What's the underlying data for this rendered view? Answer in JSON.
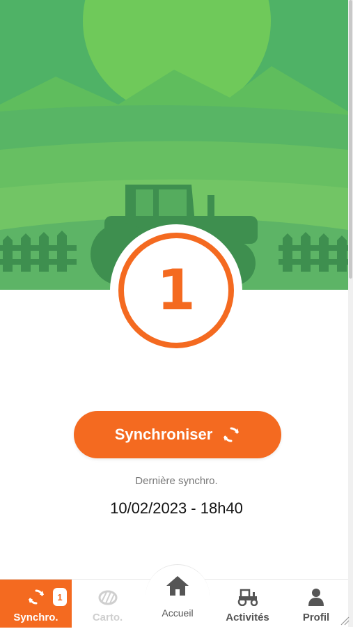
{
  "colors": {
    "accent": "#f46a20",
    "hero_green_light": "#6fc95a",
    "hero_green_dark": "#3f9a52",
    "silhouette": "#3e8f4f"
  },
  "sync": {
    "pending_count": "1",
    "button_label": "Synchroniser",
    "button_icon": "sync-icon",
    "last_sync_label": "Dernière synchro.",
    "last_sync_value": "10/02/2023 - 18h40"
  },
  "nav": {
    "items": [
      {
        "label": "Synchro.",
        "icon": "sync-icon",
        "badge": "1",
        "active": true
      },
      {
        "label": "Carto.",
        "icon": "map-icon",
        "disabled": true
      },
      {
        "label": "Accueil",
        "icon": "home-icon"
      },
      {
        "label": "Activités",
        "icon": "tractor-icon"
      },
      {
        "label": "Profil",
        "icon": "user-icon"
      }
    ]
  }
}
